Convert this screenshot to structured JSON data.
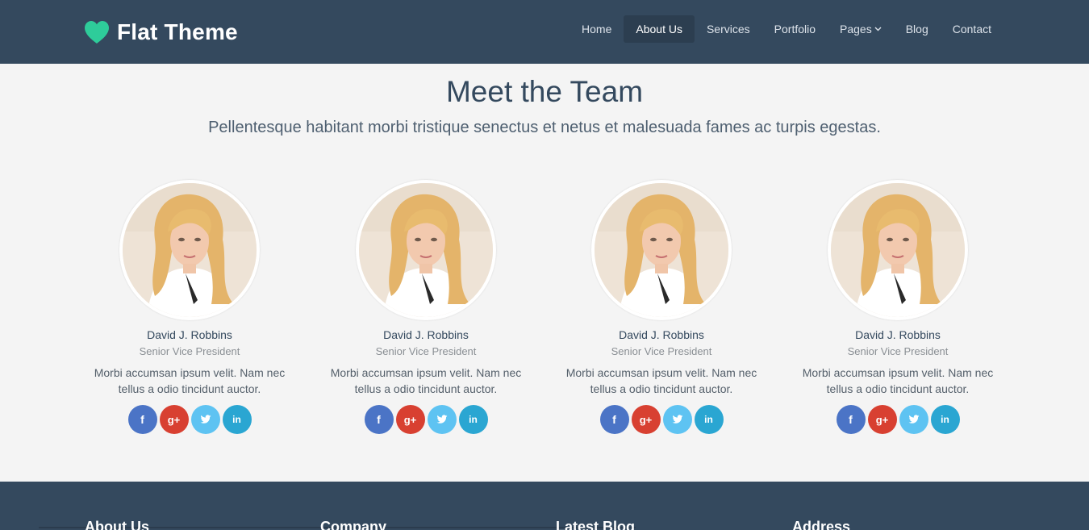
{
  "header": {
    "brand": "Flat Theme",
    "logo_icon": "heart-icon",
    "nav": [
      {
        "label": "Home",
        "active": false
      },
      {
        "label": "About Us",
        "active": true
      },
      {
        "label": "Services",
        "active": false
      },
      {
        "label": "Portfolio",
        "active": false
      },
      {
        "label": "Pages",
        "active": false,
        "dropdown": true
      },
      {
        "label": "Blog",
        "active": false
      },
      {
        "label": "Contact",
        "active": false
      }
    ]
  },
  "main": {
    "title": "Meet the Team",
    "subtitle": "Pellentesque habitant morbi tristique senectus et netus et malesuada fames ac turpis egestas.",
    "members": [
      {
        "name": "David J. Robbins",
        "role": "Senior Vice President",
        "bio": "Morbi accumsan ipsum velit. Nam nec tellus a odio tincidunt auctor."
      },
      {
        "name": "David J. Robbins",
        "role": "Senior Vice President",
        "bio": "Morbi accumsan ipsum velit. Nam nec tellus a odio tincidunt auctor."
      },
      {
        "name": "David J. Robbins",
        "role": "Senior Vice President",
        "bio": "Morbi accumsan ipsum velit. Nam nec tellus a odio tincidunt auctor."
      },
      {
        "name": "David J. Robbins",
        "role": "Senior Vice President",
        "bio": "Morbi accumsan ipsum velit. Nam nec tellus a odio tincidunt auctor."
      }
    ],
    "social": {
      "facebook": "f",
      "google_plus": "g+",
      "twitter": "twitter-icon",
      "linkedin": "in"
    }
  },
  "footer": {
    "columns": [
      "About Us",
      "Company",
      "Latest Blog",
      "Address"
    ]
  },
  "colors": {
    "header_bg": "#34495e",
    "accent": "#2ecc9a",
    "facebook": "#4b74c6",
    "google_plus": "#d84031",
    "twitter": "#5ec3f2",
    "linkedin": "#2aa6d2"
  }
}
